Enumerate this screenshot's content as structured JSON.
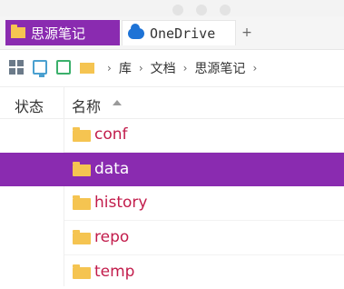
{
  "tabs": [
    {
      "label": "思源笔记",
      "icon": "folder-icon",
      "active": true
    },
    {
      "label": "OneDrive",
      "icon": "cloud-icon",
      "active": false
    }
  ],
  "new_tab_label": "+",
  "toolbar": {
    "icons": [
      "grid-icon",
      "monitor-icon",
      "network-icon",
      "folder-icon"
    ],
    "breadcrumb": [
      "库",
      "文档",
      "思源笔记"
    ]
  },
  "columns": {
    "status": "状态",
    "name": "名称"
  },
  "files": [
    {
      "name": "conf",
      "selected": false
    },
    {
      "name": "data",
      "selected": true
    },
    {
      "name": "history",
      "selected": false
    },
    {
      "name": "repo",
      "selected": false
    },
    {
      "name": "temp",
      "selected": false
    }
  ],
  "colors": {
    "accent": "#8a2bb0",
    "file_name": "#c21c4b",
    "folder": "#f5c451"
  }
}
